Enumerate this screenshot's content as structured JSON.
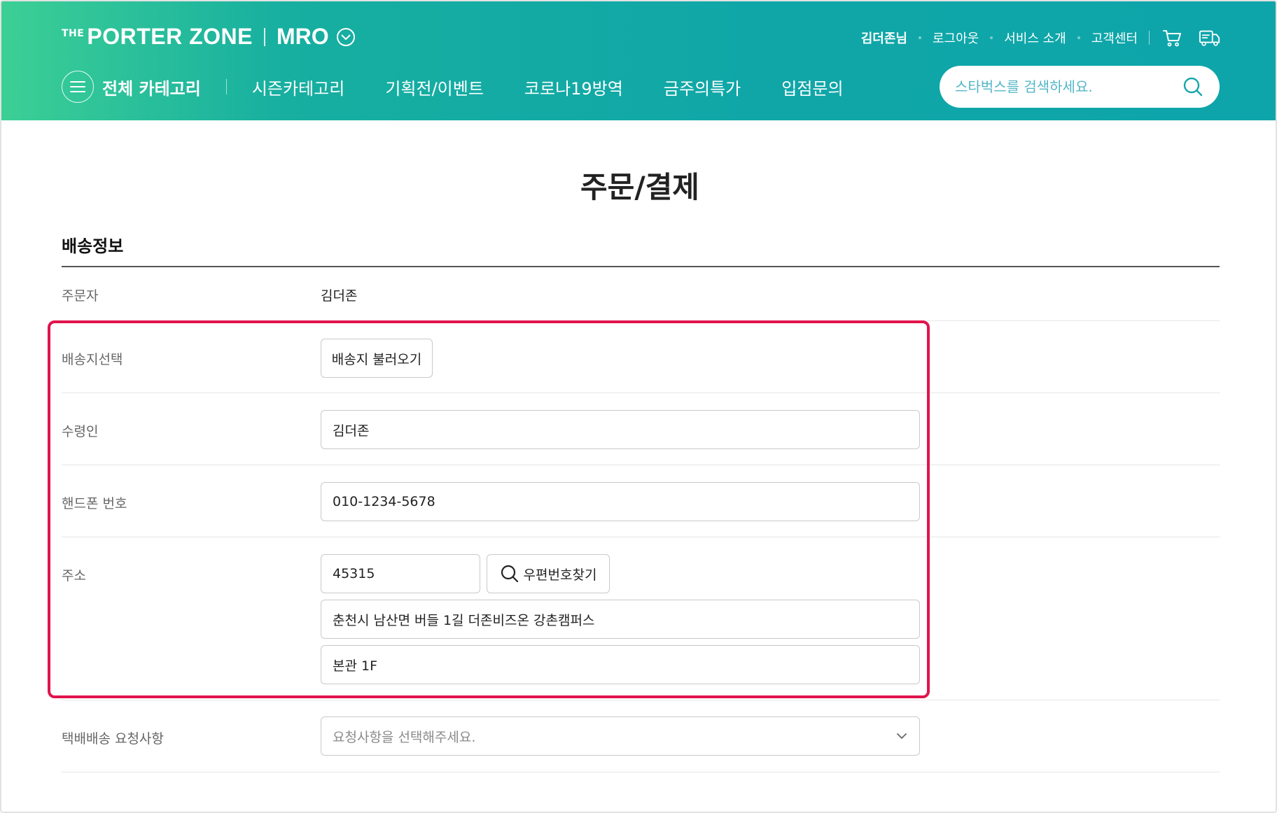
{
  "header": {
    "logo": {
      "prefix": "THE",
      "brand": "PORTER ZONE",
      "sub": "MRO"
    },
    "util": {
      "user": "김더존님",
      "logout": "로그아웃",
      "about": "서비스 소개",
      "support": "고객센터",
      "cart_icon": "cart-icon",
      "delivery_icon": "delivery-truck-icon"
    },
    "nav": {
      "all_label": "전체 카테고리",
      "items": [
        "시즌카테고리",
        "기획전/이벤트",
        "코로나19방역",
        "금주의특가",
        "입점문의"
      ]
    },
    "search": {
      "placeholder": "스타벅스를 검색하세요.",
      "icon": "search-icon"
    }
  },
  "page": {
    "title": "주문/결제"
  },
  "shipping": {
    "section_title": "배송정보",
    "orderer": {
      "label": "주문자",
      "value": "김더존"
    },
    "address_select": {
      "label": "배송지선택",
      "button": "배송지 불러오기"
    },
    "recipient": {
      "label": "수령인",
      "value": "김더존"
    },
    "phone": {
      "label": "핸드폰 번호",
      "value": "010-1234-5678"
    },
    "address": {
      "label": "주소",
      "zipcode": "45315",
      "zip_button": "우편번호찾기",
      "line1": "춘천시 남산면 버들 1길 더존비즈온 강촌캠퍼스",
      "line2": "본관 1F"
    },
    "request": {
      "label": "택배배송 요청사항",
      "placeholder": "요청사항을 선택해주세요."
    }
  },
  "colors": {
    "header_start": "#3ccf95",
    "header_end": "#0ea5aa",
    "highlight": "#e0144c"
  }
}
